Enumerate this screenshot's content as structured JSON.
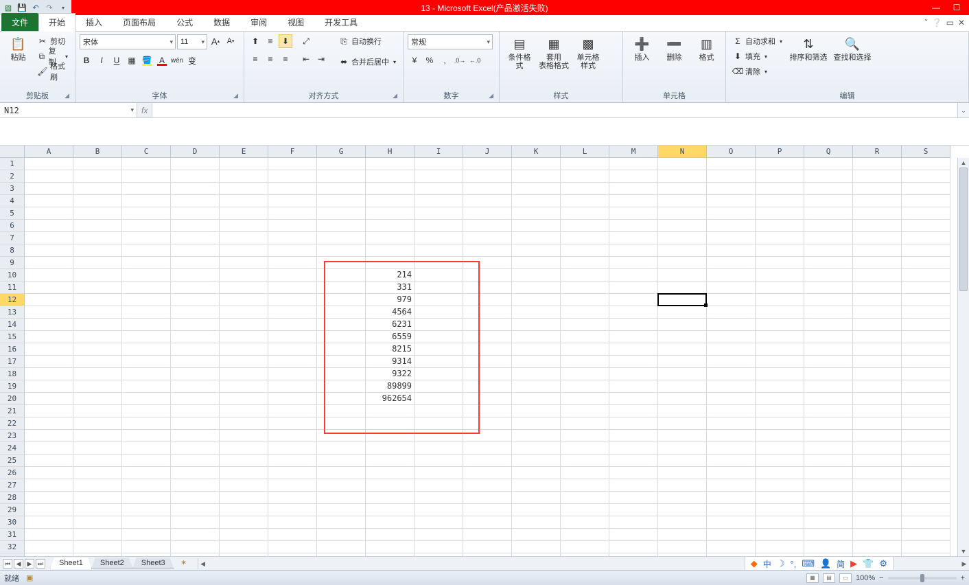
{
  "title": "13 - Microsoft Excel(产品激活失败)",
  "tabs": {
    "file": "文件",
    "start": "开始",
    "insert": "插入",
    "layout": "页面布局",
    "formula": "公式",
    "data": "数据",
    "review": "审阅",
    "view": "视图",
    "dev": "开发工具"
  },
  "ribbon": {
    "clipboard": {
      "paste": "粘贴",
      "cut": "剪切",
      "copy": "复制",
      "brush": "格式刷",
      "label": "剪贴板"
    },
    "font": {
      "name": "宋体",
      "size": "11",
      "label": "字体"
    },
    "align": {
      "wrap": "自动换行",
      "merge": "合并后居中",
      "label": "对齐方式"
    },
    "number": {
      "format": "常规",
      "label": "数字"
    },
    "style": {
      "cond": "条件格式",
      "table": "套用\n表格格式",
      "cell": "单元格样式",
      "label": "样式"
    },
    "cells": {
      "insert": "插入",
      "delete": "删除",
      "format": "格式",
      "label": "单元格"
    },
    "edit": {
      "sum": "自动求和",
      "fill": "填充",
      "clear": "清除",
      "sort": "排序和筛选",
      "find": "查找和选择",
      "label": "编辑"
    }
  },
  "namebox": "N12",
  "columns": [
    "A",
    "B",
    "C",
    "D",
    "E",
    "F",
    "G",
    "H",
    "I",
    "J",
    "K",
    "L",
    "M",
    "N",
    "O",
    "P",
    "Q",
    "R",
    "S"
  ],
  "active_col_index": 13,
  "active_row": 12,
  "row_count": 33,
  "cell_values": {
    "H10": "214",
    "H11": "331",
    "H12": "979",
    "H13": "4564",
    "H14": "6231",
    "H15": "6559",
    "H16": "8215",
    "H17": "9314",
    "H18": "9322",
    "H19": "89899",
    "H20": "962654"
  },
  "sheets": [
    "Sheet1",
    "Sheet2",
    "Sheet3"
  ],
  "active_sheet": 0,
  "status": {
    "ready": "就绪",
    "zoom": "100%"
  },
  "tray": {
    "lang": "中",
    "simp": "简"
  }
}
